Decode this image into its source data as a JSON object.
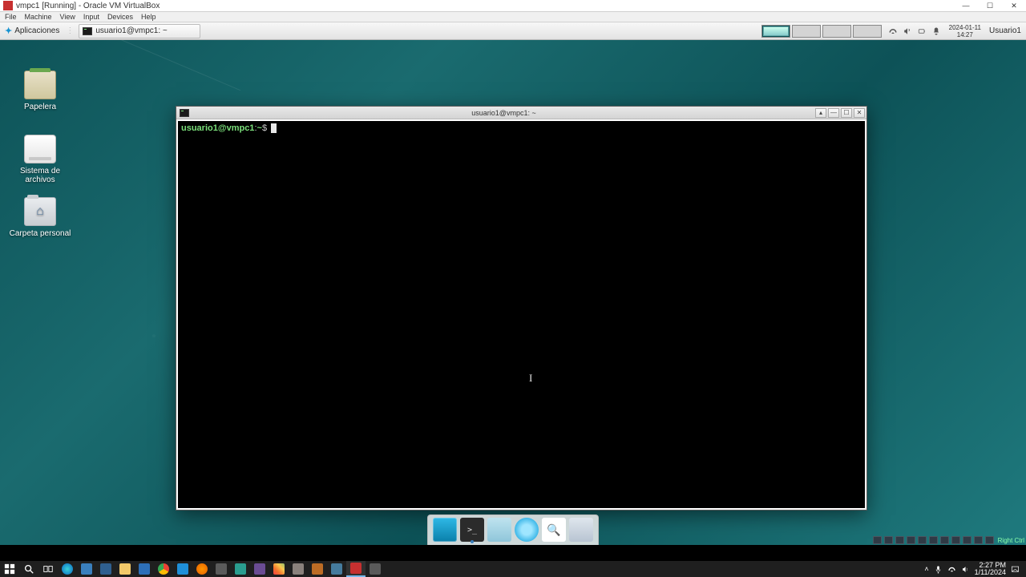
{
  "host": {
    "title": "vmpc1 [Running] - Oracle VM VirtualBox",
    "menu": [
      "File",
      "Machine",
      "View",
      "Input",
      "Devices",
      "Help"
    ],
    "win_min": "—",
    "win_max": "☐",
    "win_close": "✕",
    "statusbar_hint": "Right Ctrl"
  },
  "xfce": {
    "apps_label": "Aplicaciones",
    "task_label": "usuario1@vmpc1: ~",
    "date": "2024-01-11",
    "time": "14:27",
    "user": "Usuario1"
  },
  "desktop_icons": {
    "trash": "Papelera",
    "filesystem": "Sistema de archivos",
    "home": "Carpeta personal"
  },
  "terminal": {
    "title": "usuario1@vmpc1: ~",
    "prompt_user": "usuario1@vmpc1",
    "prompt_sep": ":",
    "prompt_path": "~",
    "prompt_sym": "$",
    "btn_up": "▴",
    "btn_min": "—",
    "btn_max": "☐",
    "btn_close": "✕"
  },
  "win_tray": {
    "time": "2:27 PM",
    "date": "1/11/2024",
    "chevron": "˄"
  }
}
